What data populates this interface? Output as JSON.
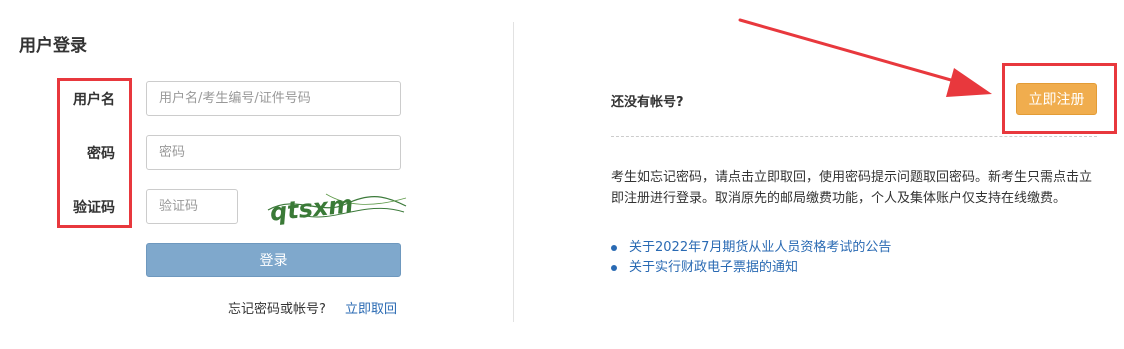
{
  "login": {
    "title": "用户登录",
    "username_label": "用户名",
    "username_placeholder": "用户名/考生编号/证件号码",
    "password_label": "密码",
    "password_placeholder": "密码",
    "captcha_label": "验证码",
    "captcha_placeholder": "验证码",
    "captcha_text": "qtsxm",
    "login_button": "登录",
    "forgot_text": "忘记密码或帐号?",
    "forgot_link": "立即取回"
  },
  "register": {
    "prompt": "还没有帐号?",
    "button": "立即注册",
    "notice": "考生如忘记密码，请点击立即取回，使用密码提示问题取回密码。新考生只需点击立即注册进行登录。取消原先的邮局缴费功能，个人及集体账户仅支持在线缴费。",
    "links": [
      "关于2022年7月期货从业人员资格考试的公告",
      "关于实行财政电子票据的通知"
    ]
  },
  "colors": {
    "annotation_red": "#e8383d",
    "login_button": "#7fa8cc",
    "register_button": "#f0ad4e",
    "link": "#2a6ab3"
  },
  "icons": {
    "arrow": "red-arrow-pointing-to-register",
    "bullet": "blue-dot"
  }
}
